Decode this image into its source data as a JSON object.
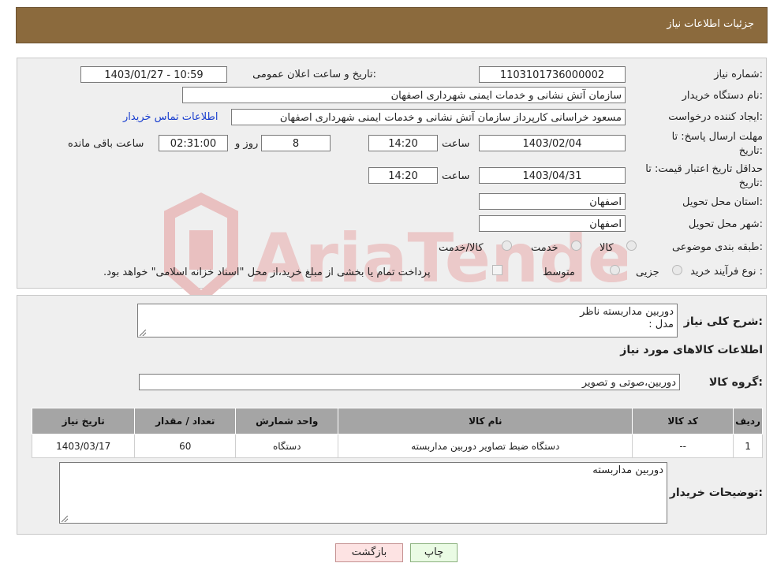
{
  "header": {
    "title": "جزئیات اطلاعات نیاز"
  },
  "fields": {
    "need_number_label": "شماره نیاز:",
    "need_number": "1103101736000002",
    "announce_label": "تاریخ و ساعت اعلان عمومی:",
    "announce_value": "1403/01/27 - 10:59",
    "buyer_org_label": "نام دستگاه خریدار:",
    "buyer_org": "سازمان آتش نشانی و خدمات ایمنی شهرداری اصفهان",
    "creator_label": "ایجاد کننده درخواست:",
    "creator": "مسعود خراسانی کارپرداز سازمان آتش نشانی و خدمات ایمنی شهرداری اصفهان",
    "contact_link": "اطلاعات تماس خریدار",
    "deadline_label_1": "مهلت ارسال پاسخ: تا",
    "deadline_label_2": "تاریخ:",
    "deadline_date": "1403/02/04",
    "time_label": "ساعت",
    "deadline_time": "14:20",
    "days_value": "8",
    "days_label": "روز و",
    "remaining_time": "02:31:00",
    "remaining_label": "ساعت باقی مانده",
    "validity_label_1": "حداقل تاریخ اعتبار قیمت: تا",
    "validity_label_2": "تاریخ:",
    "validity_date": "1403/04/31",
    "validity_time": "14:20",
    "province_label": "استان محل تحویل:",
    "province": "اصفهان",
    "city_label": "شهر محل تحویل:",
    "city": "اصفهان",
    "category_label": "طبقه بندی موضوعی:",
    "category_options": [
      "کالا",
      "خدمت",
      "کالا/خدمت"
    ],
    "purchase_type_label": "نوع فرآیند خرید :",
    "purchase_options": [
      "جزیی",
      "متوسط"
    ],
    "payment_note": "پرداخت تمام یا بخشی از مبلغ خرید،از محل \"اسناد خزانه اسلامی\" خواهد بود."
  },
  "details": {
    "summary_label": "شرح کلی نیاز:",
    "summary_line1": "دوربین مداربسته ناظر",
    "summary_line2": "مدل :",
    "goods_info_title": "اطلاعات کالاهای مورد نیاز",
    "goods_group_label": "گروه کالا:",
    "goods_group": "دوربین،صوتی و تصویر",
    "table": {
      "headers": [
        "ردیف",
        "کد کالا",
        "نام کالا",
        "واحد شمارش",
        "تعداد / مقدار",
        "تاریخ نیاز"
      ],
      "rows": [
        [
          "1",
          "--",
          "دستگاه ضبط تصاویر دوربین مداربسته",
          "دستگاه",
          "60",
          "1403/03/17"
        ]
      ]
    },
    "buyer_notes_label": "توضیحات خریدار:",
    "buyer_notes": "دوربین مداربسته"
  },
  "buttons": {
    "print": "چاپ",
    "back": "بازگشت"
  },
  "watermark": {
    "text": "AriaTender.neT",
    "color": "#e8b8b8"
  }
}
